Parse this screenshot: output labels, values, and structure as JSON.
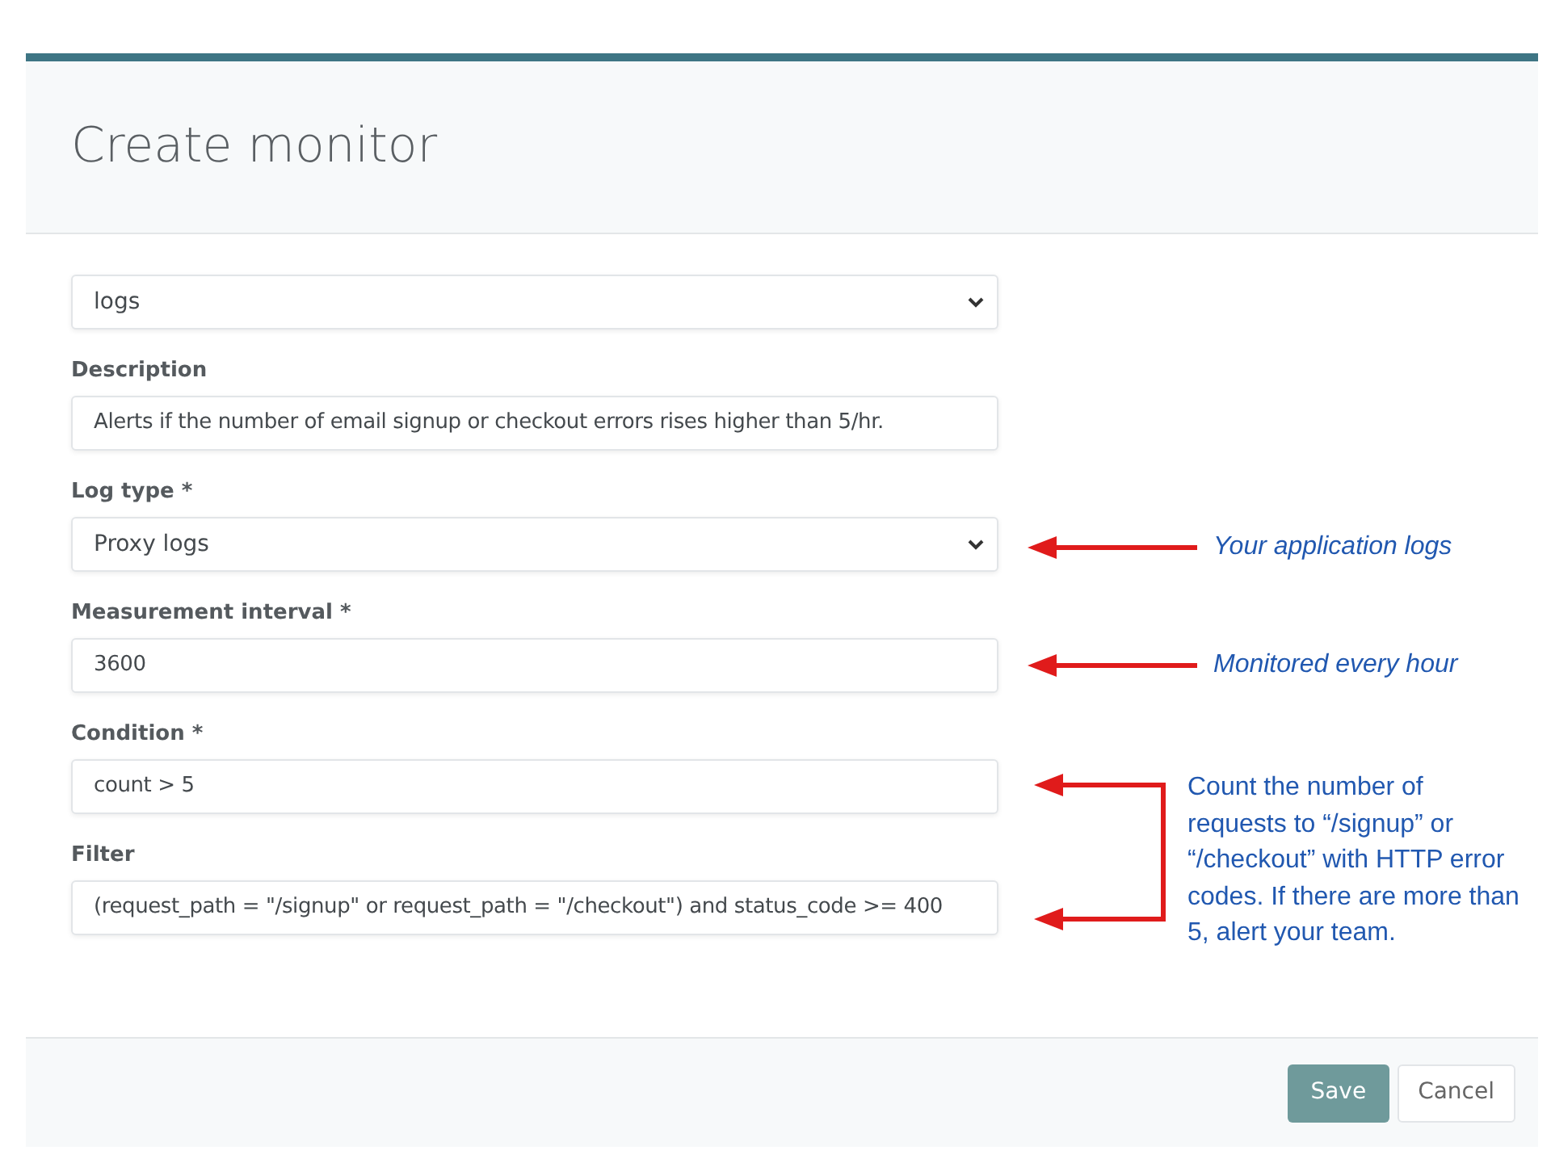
{
  "modal": {
    "title": "Create monitor"
  },
  "fields": [
    {
      "kind": "select",
      "value": "logs"
    },
    {
      "kind": "input",
      "label": "Description",
      "value": "Alerts if the number of email signup or checkout errors rises higher than 5/hr."
    },
    {
      "kind": "select",
      "label": "Log type *",
      "value": "Proxy logs"
    },
    {
      "kind": "input",
      "label": "Measurement interval *",
      "value": "3600"
    },
    {
      "kind": "input",
      "label": "Condition *",
      "value": "count > 5"
    },
    {
      "kind": "input",
      "label": "Filter",
      "value": "(request_path = \"/signup\" or request_path = \"/checkout\") and status_code >= 400"
    }
  ],
  "annotations": [
    {
      "kind": "arrow",
      "text": "Your application logs"
    },
    {
      "kind": "arrow",
      "text": "Monitored every hour"
    },
    {
      "kind": "bracket",
      "text": "Count the number of requests to “/signup” or “/checkout” with HTTP error codes. If there are more than 5, alert your team."
    }
  ],
  "buttons": [
    {
      "kind": "primary",
      "label": "Save"
    },
    {
      "kind": "secondary",
      "label": "Cancel"
    }
  ]
}
